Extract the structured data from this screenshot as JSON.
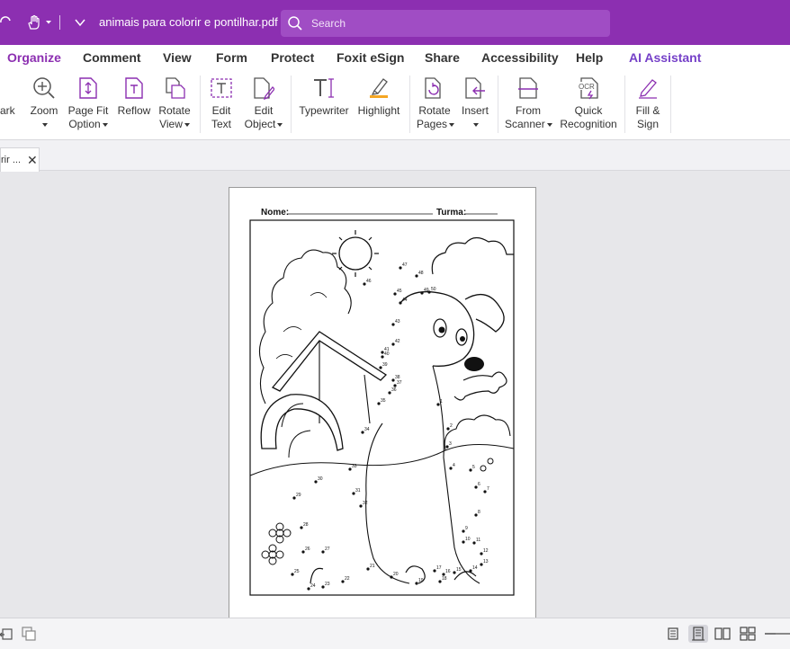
{
  "titlebar": {
    "doc_title": "animais para colorir e pontilhar.pdf - ...",
    "search_placeholder": "Search"
  },
  "menu": [
    {
      "label": "Organize",
      "name": "menu-organize"
    },
    {
      "label": "Comment",
      "name": "menu-comment"
    },
    {
      "label": "View",
      "name": "menu-view"
    },
    {
      "label": "Form",
      "name": "menu-form"
    },
    {
      "label": "Protect",
      "name": "menu-protect"
    },
    {
      "label": "Foxit eSign",
      "name": "menu-foxit-esign"
    },
    {
      "label": "Share",
      "name": "menu-share"
    },
    {
      "label": "Accessibility",
      "name": "menu-accessibility"
    },
    {
      "label": "Help",
      "name": "menu-help"
    },
    {
      "label": "AI Assistant",
      "name": "menu-ai-assistant"
    }
  ],
  "ribbon": {
    "bookmark_partial": "ark",
    "zoom": "Zoom",
    "page_fit_1": "Page Fit",
    "page_fit_2": "Option",
    "reflow": "Reflow",
    "rotate_view_1": "Rotate",
    "rotate_view_2": "View",
    "edit_text_1": "Edit",
    "edit_text_2": "Text",
    "edit_object_1": "Edit",
    "edit_object_2": "Object",
    "typewriter": "Typewriter",
    "highlight": "Highlight",
    "rotate_pages_1": "Rotate",
    "rotate_pages_2": "Pages",
    "insert": "Insert",
    "from_scanner_1": "From",
    "from_scanner_2": "Scanner",
    "quick_recognition_1": "Quick",
    "quick_recognition_2": "Recognition",
    "fill_sign_1": "Fill &",
    "fill_sign_2": "Sign"
  },
  "tab": {
    "label": "rir ...",
    "close": "✕"
  },
  "worksheet": {
    "nome_label": "Nome:",
    "turma_label": "Turma:",
    "dot_numbers": [
      "1",
      "2",
      "3",
      "4",
      "5",
      "6",
      "7",
      "8",
      "9",
      "10",
      "11",
      "12",
      "13",
      "14",
      "15",
      "16",
      "17",
      "18",
      "19",
      "20",
      "21",
      "22",
      "23",
      "24",
      "25",
      "26",
      "27",
      "28",
      "29",
      "30",
      "31",
      "32",
      "33",
      "34",
      "35",
      "36",
      "37",
      "38",
      "39",
      "40",
      "41",
      "42",
      "43",
      "44",
      "45",
      "46",
      "47",
      "48",
      "49",
      "50"
    ]
  },
  "colors": {
    "titlebar": "#8c2fb1",
    "accent": "#8c2fb1",
    "ai": "#7540c8",
    "icon_purple": "#8c2fb1"
  }
}
